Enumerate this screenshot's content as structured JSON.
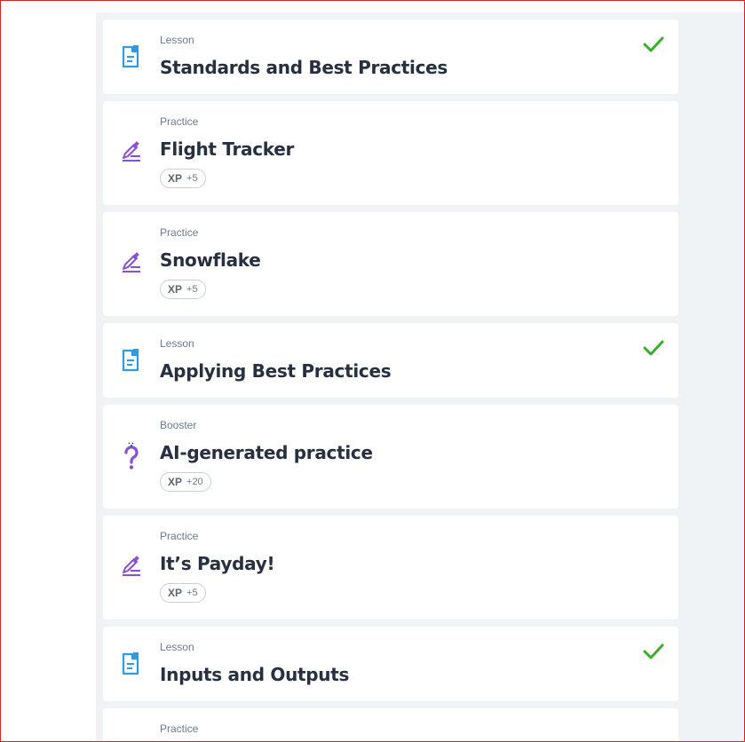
{
  "items": [
    {
      "type": "Lesson",
      "title": "Standards and Best Practices",
      "icon": "lesson-doc-icon",
      "completed": true
    },
    {
      "type": "Practice",
      "title": "Flight Tracker",
      "icon": "practice-pencil-icon",
      "xp_label": "XP",
      "xp_value": "+5"
    },
    {
      "type": "Practice",
      "title": "Snowflake",
      "icon": "practice-pencil-icon",
      "xp_label": "XP",
      "xp_value": "+5"
    },
    {
      "type": "Lesson",
      "title": "Applying Best Practices",
      "icon": "lesson-doc-icon",
      "completed": true
    },
    {
      "type": "Booster",
      "title": "AI-generated practice",
      "icon": "booster-question-icon",
      "xp_label": "XP",
      "xp_value": "+20"
    },
    {
      "type": "Practice",
      "title": "It’s Payday!",
      "icon": "practice-pencil-icon",
      "xp_label": "XP",
      "xp_value": "+5"
    },
    {
      "type": "Lesson",
      "title": "Inputs and Outputs",
      "icon": "lesson-doc-icon",
      "completed": true
    },
    {
      "type": "Practice",
      "title": "",
      "icon": "practice-pencil-icon"
    }
  ],
  "colors": {
    "lesson_icon": "#2e9be0",
    "practice_icon": "#8a4fd8",
    "check": "#3aae2a",
    "background": "#f0f3f6"
  }
}
